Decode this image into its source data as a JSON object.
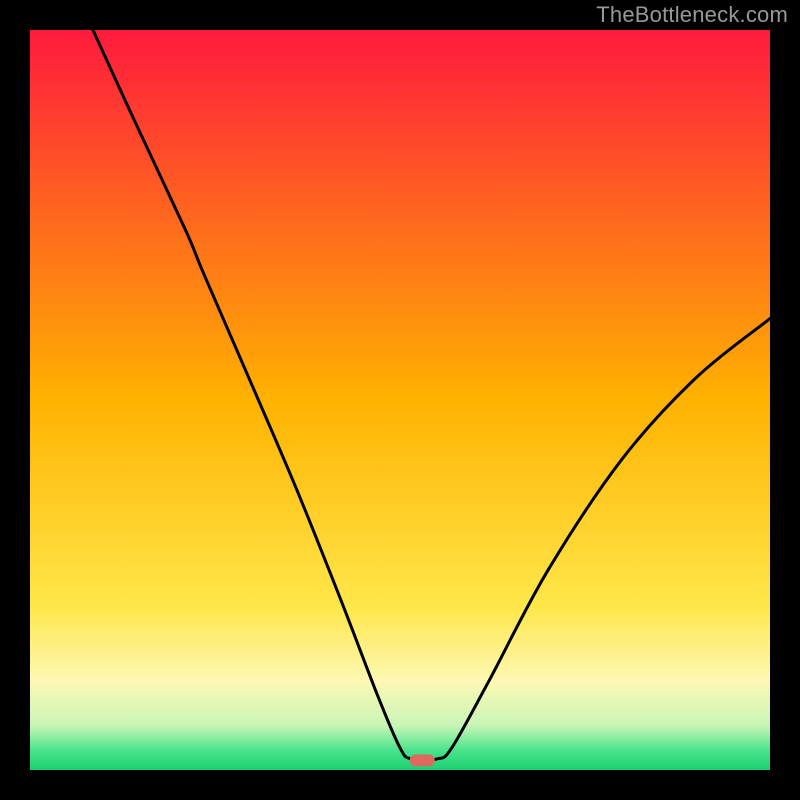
{
  "watermark": "TheBottleneck.com",
  "chart_data": {
    "type": "line",
    "title": "",
    "xlabel": "",
    "ylabel": "",
    "xlim": [
      0,
      100
    ],
    "ylim": [
      0,
      100
    ],
    "background_gradient": {
      "stops": [
        {
          "offset": 0.0,
          "color": "#ff1a3d"
        },
        {
          "offset": 0.5,
          "color": "#ffb200"
        },
        {
          "offset": 0.78,
          "color": "#ffe74a"
        },
        {
          "offset": 0.88,
          "color": "#fdf8b4"
        },
        {
          "offset": 0.94,
          "color": "#c9f5b6"
        },
        {
          "offset": 0.975,
          "color": "#44e38a"
        },
        {
          "offset": 1.0,
          "color": "#1ccf70"
        }
      ]
    },
    "curve": {
      "description": "V-shaped bottleneck curve; minimum ≈ x=53, y≈1",
      "points": [
        {
          "x": 8.5,
          "y": 100
        },
        {
          "x": 14,
          "y": 88
        },
        {
          "x": 21,
          "y": 73
        },
        {
          "x": 23.5,
          "y": 67
        },
        {
          "x": 30,
          "y": 52
        },
        {
          "x": 36,
          "y": 38
        },
        {
          "x": 42,
          "y": 23
        },
        {
          "x": 47,
          "y": 10
        },
        {
          "x": 50,
          "y": 3
        },
        {
          "x": 51.5,
          "y": 1.5
        },
        {
          "x": 55,
          "y": 1.5
        },
        {
          "x": 57,
          "y": 3
        },
        {
          "x": 62,
          "y": 12
        },
        {
          "x": 70,
          "y": 27
        },
        {
          "x": 80,
          "y": 42
        },
        {
          "x": 90,
          "y": 53
        },
        {
          "x": 100,
          "y": 61
        }
      ]
    },
    "marker": {
      "x": 53,
      "y": 1.3,
      "color": "#e0695f",
      "width": 3.4,
      "height": 1.6
    }
  }
}
